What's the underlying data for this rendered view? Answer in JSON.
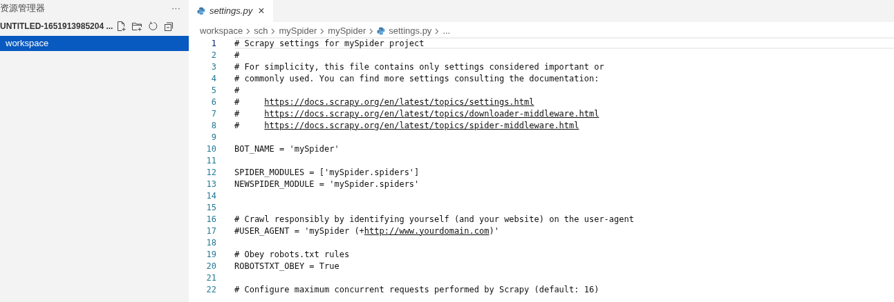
{
  "sidebar": {
    "title": "资源管理器",
    "more": "···",
    "workspace_header": "UNTITLED-1651913985204 ...",
    "items": [
      {
        "label": "workspace",
        "selected": true
      }
    ]
  },
  "tabs": [
    {
      "label": "settings.py",
      "selected": true,
      "close": "×"
    }
  ],
  "breadcrumbs": [
    {
      "label": "workspace",
      "kind": "folder"
    },
    {
      "label": "sch",
      "kind": "folder"
    },
    {
      "label": "mySpider",
      "kind": "folder"
    },
    {
      "label": "mySpider",
      "kind": "folder"
    },
    {
      "label": "settings.py",
      "kind": "file"
    },
    {
      "label": "...",
      "kind": "folder"
    }
  ],
  "editor": {
    "lines": [
      {
        "number": "1",
        "current": true,
        "segments": [
          {
            "kind": "text",
            "text": "# Scrapy settings for mySpider project"
          }
        ]
      },
      {
        "number": "2",
        "current": false,
        "segments": [
          {
            "kind": "text",
            "text": "#"
          }
        ]
      },
      {
        "number": "3",
        "current": false,
        "segments": [
          {
            "kind": "text",
            "text": "# For simplicity, this file contains only settings considered important or"
          }
        ]
      },
      {
        "number": "4",
        "current": false,
        "segments": [
          {
            "kind": "text",
            "text": "# commonly used. You can find more settings consulting the documentation:"
          }
        ]
      },
      {
        "number": "5",
        "current": false,
        "segments": [
          {
            "kind": "text",
            "text": "#"
          }
        ]
      },
      {
        "number": "6",
        "current": false,
        "segments": [
          {
            "kind": "text",
            "text": "#     "
          },
          {
            "kind": "link",
            "text": "https://docs.scrapy.org/en/latest/topics/settings.html"
          }
        ]
      },
      {
        "number": "7",
        "current": false,
        "segments": [
          {
            "kind": "text",
            "text": "#     "
          },
          {
            "kind": "link",
            "text": "https://docs.scrapy.org/en/latest/topics/downloader-middleware.html"
          }
        ]
      },
      {
        "number": "8",
        "current": false,
        "segments": [
          {
            "kind": "text",
            "text": "#     "
          },
          {
            "kind": "link",
            "text": "https://docs.scrapy.org/en/latest/topics/spider-middleware.html"
          }
        ]
      },
      {
        "number": "9",
        "current": false
      },
      {
        "number": "10",
        "current": false,
        "segments": [
          {
            "kind": "text",
            "text": "BOT_NAME = 'mySpider'"
          }
        ]
      },
      {
        "number": "11",
        "current": false
      },
      {
        "number": "12",
        "current": false,
        "segments": [
          {
            "kind": "text",
            "text": "SPIDER_MODULES = ['mySpider.spiders']"
          }
        ]
      },
      {
        "number": "13",
        "current": false,
        "segments": [
          {
            "kind": "text",
            "text": "NEWSPIDER_MODULE = 'mySpider.spiders'"
          }
        ]
      },
      {
        "number": "14",
        "current": false
      },
      {
        "number": "15",
        "current": false
      },
      {
        "number": "16",
        "current": false,
        "segments": [
          {
            "kind": "text",
            "text": "# Crawl responsibly by identifying yourself (and your website) on the user-agent"
          }
        ]
      },
      {
        "number": "17",
        "current": false,
        "segments": [
          {
            "kind": "text",
            "text": "#USER_AGENT = 'mySpider (+"
          },
          {
            "kind": "link",
            "text": "http://www.yourdomain.com"
          },
          {
            "kind": "text",
            "text": ")'"
          }
        ]
      },
      {
        "number": "18",
        "current": false
      },
      {
        "number": "19",
        "current": false,
        "segments": [
          {
            "kind": "text",
            "text": "# Obey robots.txt rules"
          }
        ]
      },
      {
        "number": "20",
        "current": false,
        "segments": [
          {
            "kind": "text",
            "text": "ROBOTSTXT_OBEY = True"
          }
        ]
      },
      {
        "number": "21",
        "current": false
      },
      {
        "number": "22",
        "current": false,
        "segments": [
          {
            "kind": "text",
            "text": "# Configure maximum concurrent requests performed by Scrapy (default: 16)"
          }
        ]
      }
    ]
  }
}
